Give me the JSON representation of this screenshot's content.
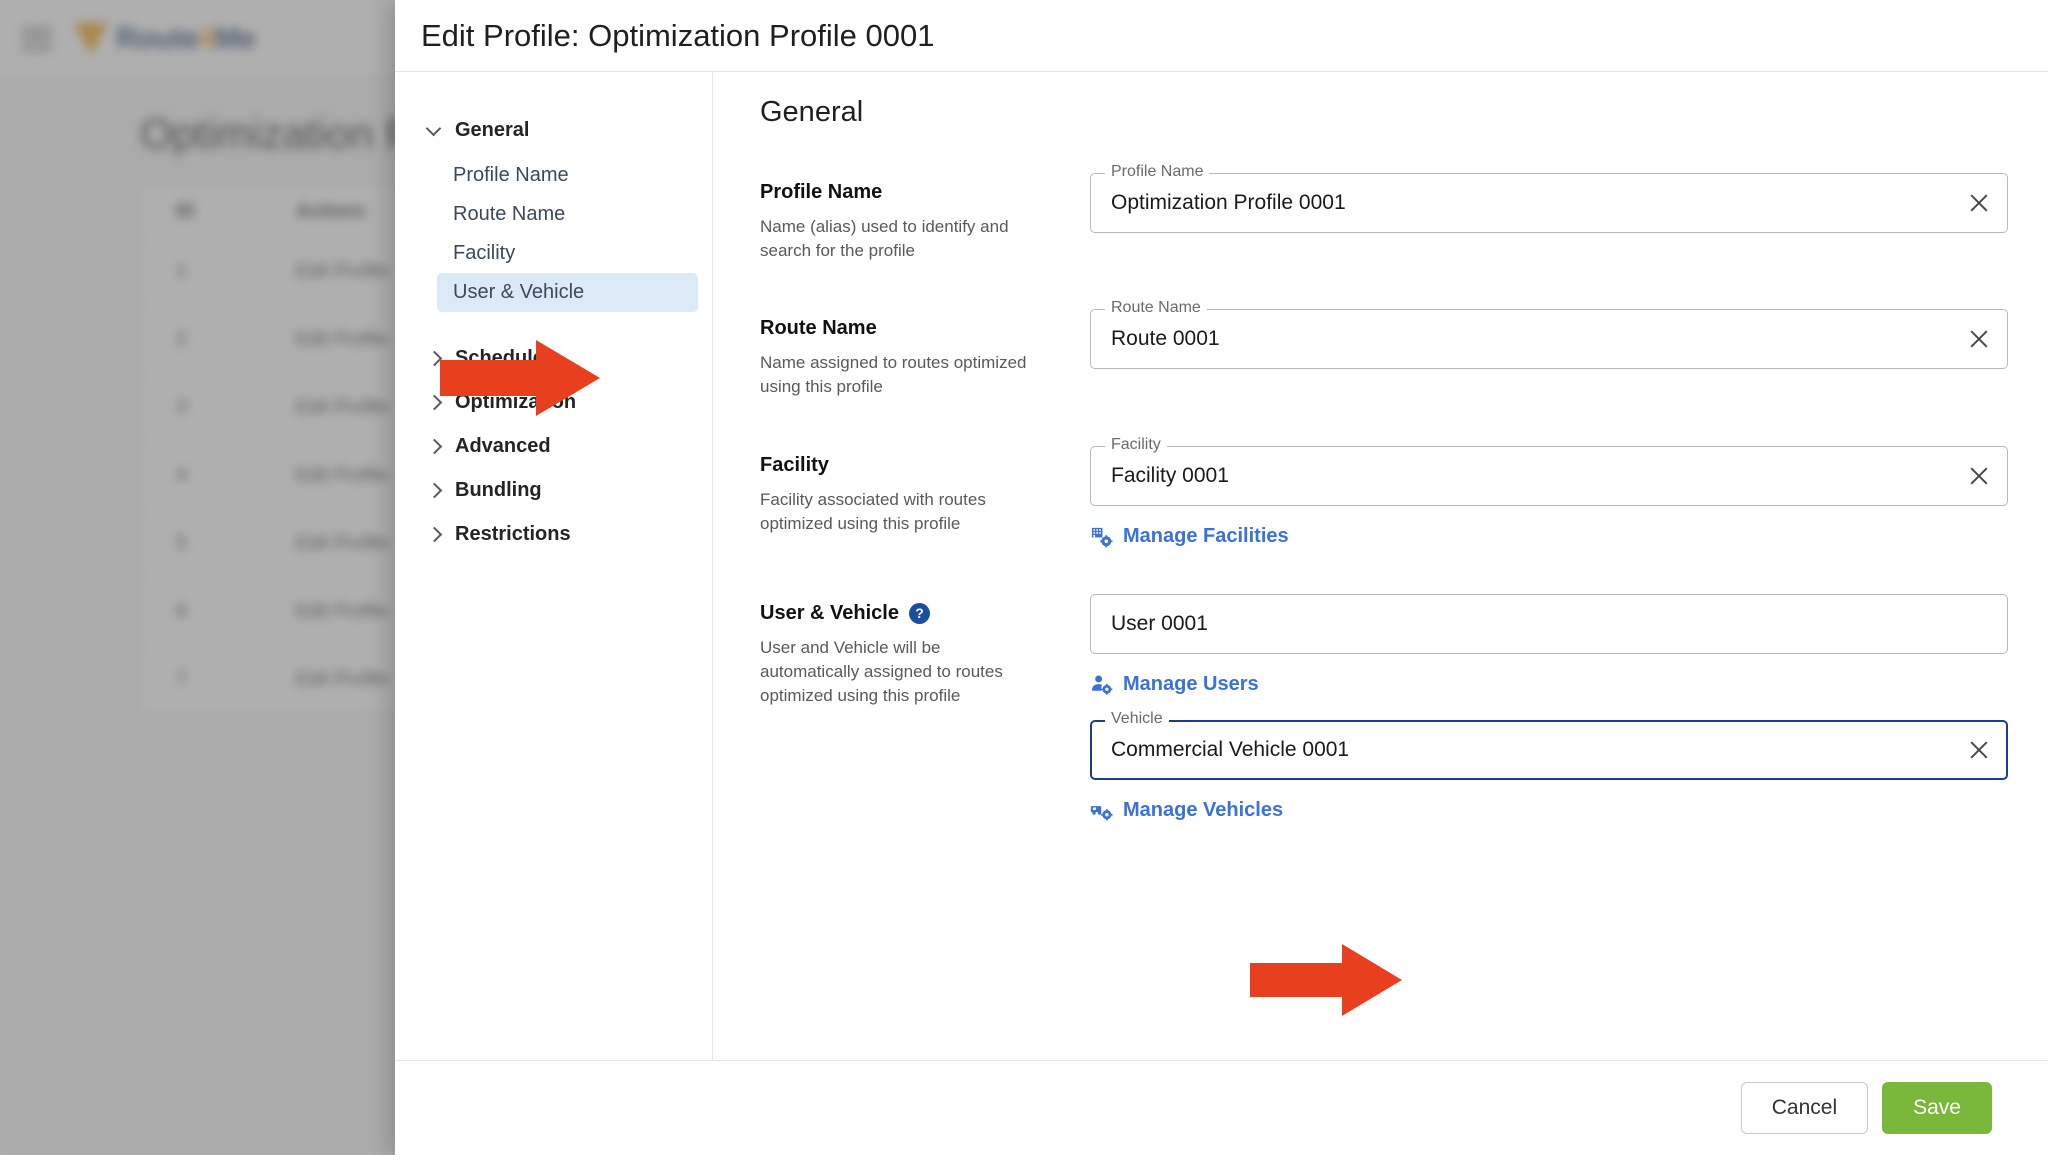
{
  "background": {
    "logo_text": "Route",
    "logo_accent": "4",
    "logo_text2": "Me",
    "page_title": "Optimization Profiles",
    "table": {
      "headers": [
        "ID",
        "Actions"
      ],
      "rows": [
        {
          "id": "1",
          "action": "Edit Profile",
          "extra": "…"
        },
        {
          "id": "2",
          "action": "Edit Profile",
          "extra": "…"
        },
        {
          "id": "3",
          "action": "Edit Profile",
          "extra": "…"
        },
        {
          "id": "4",
          "action": "Edit Profile",
          "extra": "…"
        },
        {
          "id": "5",
          "action": "Edit Profile",
          "extra": "…"
        },
        {
          "id": "6",
          "action": "Edit Profile",
          "extra": "…"
        },
        {
          "id": "7",
          "action": "Edit Profile",
          "extra": "…"
        }
      ]
    }
  },
  "modal": {
    "title": "Edit Profile: Optimization Profile 0001",
    "content_heading": "General",
    "nav": {
      "groups": [
        {
          "label": "General",
          "expanded": true,
          "items": [
            {
              "label": "Profile Name",
              "active": false
            },
            {
              "label": "Route Name",
              "active": false
            },
            {
              "label": "Facility",
              "active": false
            },
            {
              "label": "User & Vehicle",
              "active": true
            }
          ]
        },
        {
          "label": "Schedule",
          "expanded": false,
          "items": []
        },
        {
          "label": "Optimization",
          "expanded": false,
          "items": []
        },
        {
          "label": "Advanced",
          "expanded": false,
          "items": []
        },
        {
          "label": "Bundling",
          "expanded": false,
          "items": []
        },
        {
          "label": "Restrictions",
          "expanded": false,
          "items": []
        }
      ]
    },
    "fields": [
      {
        "key": "profile_name",
        "heading": "Profile Name",
        "description": "Name (alias) used to identify and search for the profile",
        "input_label": "Profile Name",
        "value": "Optimization Profile 0001",
        "has_clear": true,
        "focused": false,
        "help": false
      },
      {
        "key": "route_name",
        "heading": "Route Name",
        "description": "Name assigned to routes optimized using this profile",
        "input_label": "Route Name",
        "value": "Route 0001",
        "has_clear": true,
        "focused": false,
        "help": false
      },
      {
        "key": "facility",
        "heading": "Facility",
        "description": "Facility associated with routes optimized using this profile",
        "input_label": "Facility",
        "value": "Facility 0001",
        "has_clear": true,
        "focused": false,
        "help": false,
        "link": {
          "label": "Manage Facilities",
          "icon": "building-gear-icon"
        }
      },
      {
        "key": "user_vehicle",
        "heading": "User & Vehicle",
        "description": "User and Vehicle will be automatically assigned to routes optimized using this profile",
        "help": true,
        "help_glyph": "?",
        "input_label": "",
        "value": "User 0001",
        "has_clear": false,
        "focused": false,
        "link": {
          "label": "Manage Users",
          "icon": "user-gear-icon"
        },
        "second": {
          "input_label": "Vehicle",
          "value": "Commercial Vehicle 0001",
          "has_clear": true,
          "focused": true,
          "link": {
            "label": "Manage Vehicles",
            "icon": "vehicle-gear-icon"
          }
        }
      }
    ],
    "footer": {
      "cancel_label": "Cancel",
      "save_label": "Save"
    }
  },
  "colors": {
    "accent_link": "#3b72d9",
    "save_green": "#79b83b",
    "focus_blue": "#1f3a93",
    "active_nav_bg": "#dce9f7",
    "arrow_red": "#e8401f",
    "help_blue": "#1a4fa0"
  },
  "annotations": {
    "arrows": [
      {
        "name": "arrow-user-vehicle-nav",
        "target": "User & Vehicle"
      },
      {
        "name": "arrow-vehicle-field",
        "target": "Vehicle"
      }
    ]
  }
}
